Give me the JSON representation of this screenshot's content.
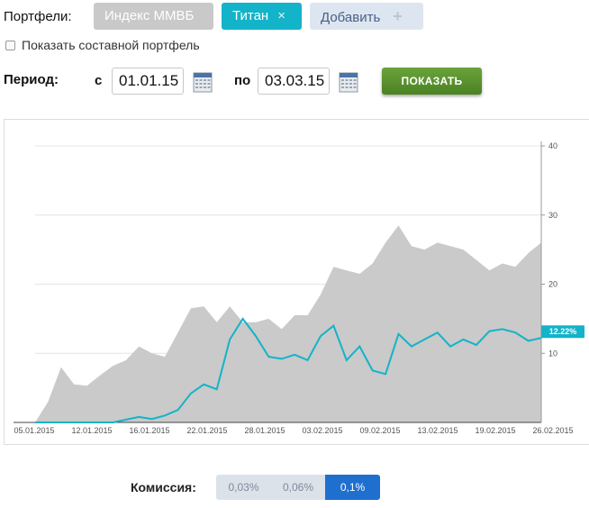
{
  "portfolios": {
    "label": "Портфели:",
    "items": [
      {
        "label": "Индекс ММВБ"
      },
      {
        "label": "Титан",
        "close_icon": "×"
      },
      {
        "label": "Добавить",
        "add_icon": "+"
      }
    ]
  },
  "composite": {
    "label": "Показать составной портфель",
    "checked": false
  },
  "period": {
    "label": "Период:",
    "from_label": "с",
    "from_value": "01.01.15",
    "to_label": "по",
    "to_value": "03.03.15",
    "show_button": "ПОКАЗАТЬ"
  },
  "chart_data": {
    "type": "area",
    "x_ticks": [
      "05.01.2015",
      "12.01.2015",
      "16.01.2015",
      "22.01.2015",
      "28.01.2015",
      "03.02.2015",
      "09.02.2015",
      "13.02.2015",
      "19.02.2015",
      "26.02.2015"
    ],
    "y_ticks": [
      "10",
      "20",
      "30",
      "40"
    ],
    "ylim": [
      0,
      40
    ],
    "current_label": "12.22%",
    "series": [
      {
        "color": "#c9cac9",
        "values": [
          0,
          3,
          8,
          5.5,
          5.3,
          6.8,
          8.2,
          9,
          11,
          10,
          9.5,
          13,
          16.5,
          16.8,
          14.5,
          16.8,
          14.5,
          14.5,
          15,
          13.5,
          15.5,
          15.5,
          18.5,
          22.5,
          22,
          21.5,
          23,
          26,
          28.5,
          25.5,
          25,
          26,
          25.5,
          25,
          23.5,
          22,
          23,
          22.5,
          24.5,
          26
        ]
      },
      {
        "color": "#13b3c9",
        "values": [
          0,
          0,
          0,
          0,
          0,
          0,
          0,
          0.4,
          0.8,
          0.5,
          1,
          1.8,
          4.2,
          5.5,
          4.8,
          12,
          15,
          12.5,
          9.5,
          9.2,
          9.8,
          9,
          12.5,
          14,
          9,
          11,
          7.5,
          7,
          12.8,
          11,
          12,
          13,
          11,
          12,
          11.2,
          13.2,
          13.5,
          13,
          11.8,
          12.22
        ]
      }
    ]
  },
  "commission": {
    "label": "Комиссия:",
    "options": [
      "0,03%",
      "0,06%",
      "0,1%"
    ],
    "selected": "0,1%"
  },
  "colors": {
    "accent": "#13b3c9",
    "area": "#c9cac9",
    "button": "#5a9230",
    "active_seg": "#1f6fcf"
  }
}
